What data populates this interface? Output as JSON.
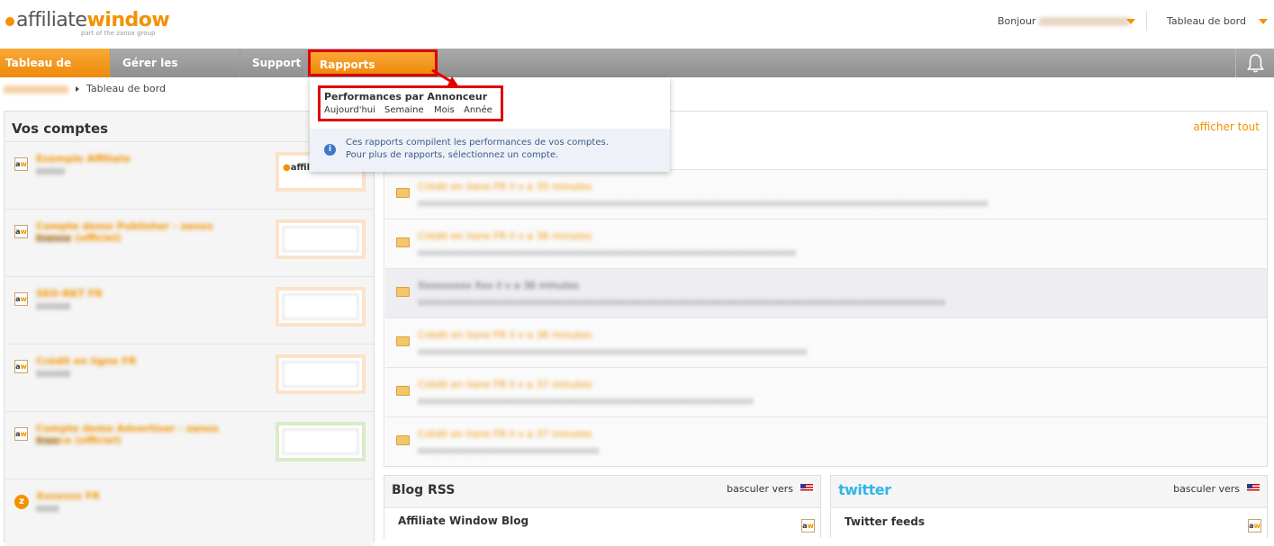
{
  "header": {
    "logo_text_a": "affiliate",
    "logo_text_b": "window",
    "logo_tagline": "part of the zanox group",
    "greeting": "Bonjour",
    "dashboard_link": "Tableau de bord"
  },
  "nav": {
    "items": [
      {
        "label": "Tableau de bord"
      },
      {
        "label": "Gérer les comptes"
      },
      {
        "label": "Support"
      },
      {
        "label": "Rapports Editeurs"
      }
    ]
  },
  "breadcrumb": {
    "current": "Tableau de bord"
  },
  "dropdown": {
    "section_title": "Performances par Annonceur",
    "links": [
      "Aujourd'hui",
      "Semaine",
      "Mois",
      "Année"
    ],
    "info_line1": "Ces rapports compilent les performances de vos comptes.",
    "info_line2": "Pour plus de rapports, sélectionnez un compte."
  },
  "accounts": {
    "title": "Vos comptes",
    "thumb_text": "affili"
  },
  "activity": {
    "show_all": "afficher tout"
  },
  "blog": {
    "title": "Blog RSS",
    "toggle": "basculer vers",
    "feed_title": "Affiliate Window Blog"
  },
  "twitter": {
    "logo": "twitter",
    "toggle": "basculer vers",
    "feed_title": "Twitter feeds"
  },
  "colors": {
    "accent": "#f39200",
    "nav_grey": "#9a9a9a",
    "highlight_red": "#e00000",
    "info_blue": "#3a5a8c"
  }
}
